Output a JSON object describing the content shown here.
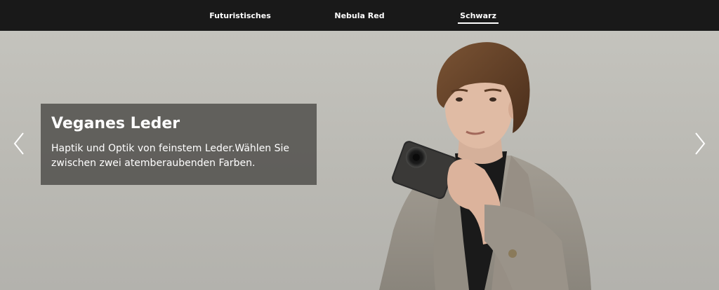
{
  "tabs": [
    {
      "label": "Futuristisches",
      "active": false
    },
    {
      "label": "Nebula Red",
      "active": false
    },
    {
      "label": "Schwarz",
      "active": true
    }
  ],
  "hero": {
    "title": "Veganes Leder",
    "description": "Haptik und Optik von feinstem Leder.Wählen Sie zwischen zwei atemberaubenden Farben.",
    "background_color": "#bdbcb6",
    "caption_box_color": "#52504d",
    "image_subject": "model holding phone with black vegan leather back"
  },
  "nav": {
    "prev_icon": "chevron-left-icon",
    "next_icon": "chevron-right-icon"
  },
  "colors": {
    "tabbar": "#191919",
    "tab_text": "#ffffff"
  }
}
